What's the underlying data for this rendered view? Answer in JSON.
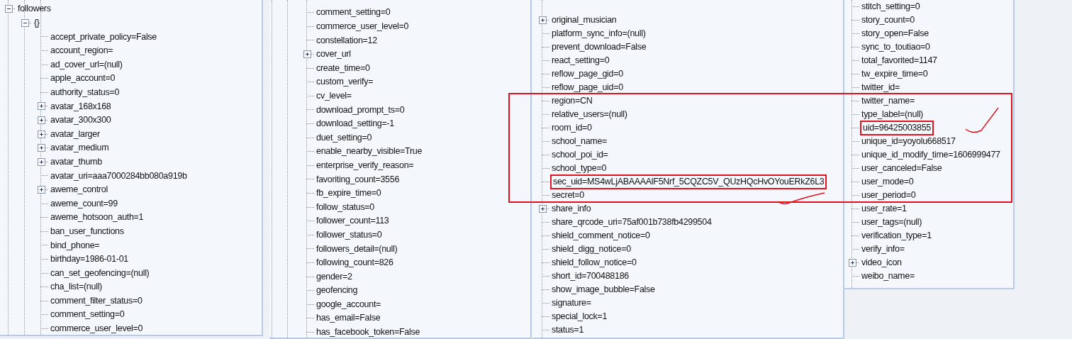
{
  "panels": [
    {
      "items": [
        {
          "kind": "node",
          "text": "followers",
          "expanded": true,
          "children": [
            {
              "kind": "node",
              "text": "{}",
              "expanded": true,
              "children": [
                {
                  "kind": "leaf",
                  "text": "accept_private_policy=False"
                },
                {
                  "kind": "leaf",
                  "text": "account_region="
                },
                {
                  "kind": "leaf",
                  "text": "ad_cover_url=(null)"
                },
                {
                  "kind": "leaf",
                  "text": "apple_account=0"
                },
                {
                  "kind": "leaf",
                  "text": "authority_status=0"
                },
                {
                  "kind": "node",
                  "text": "avatar_168x168",
                  "expanded": false
                },
                {
                  "kind": "node",
                  "text": "avatar_300x300",
                  "expanded": false
                },
                {
                  "kind": "node",
                  "text": "avatar_larger",
                  "expanded": false
                },
                {
                  "kind": "node",
                  "text": "avatar_medium",
                  "expanded": false
                },
                {
                  "kind": "node",
                  "text": "avatar_thumb",
                  "expanded": false
                },
                {
                  "kind": "leaf",
                  "text": "avatar_uri=aaa7000284bb080a919b"
                },
                {
                  "kind": "node",
                  "text": "aweme_control",
                  "expanded": false
                },
                {
                  "kind": "leaf",
                  "text": "aweme_count=99"
                },
                {
                  "kind": "leaf",
                  "text": "aweme_hotsoon_auth=1"
                },
                {
                  "kind": "leaf",
                  "text": "ban_user_functions"
                },
                {
                  "kind": "leaf",
                  "text": "bind_phone="
                },
                {
                  "kind": "leaf",
                  "text": "birthday=1986-01-01"
                },
                {
                  "kind": "leaf",
                  "text": "can_set_geofencing=(null)"
                },
                {
                  "kind": "leaf",
                  "text": "cha_list=(null)"
                },
                {
                  "kind": "leaf",
                  "text": "comment_filter_status=0"
                },
                {
                  "kind": "leaf",
                  "text": "comment_setting=0"
                },
                {
                  "kind": "leaf",
                  "text": "commerce_user_level=0"
                }
              ]
            }
          ]
        }
      ]
    },
    {
      "items": [
        {
          "kind": "leaf",
          "text": "comment_setting=0"
        },
        {
          "kind": "leaf",
          "text": "commerce_user_level=0"
        },
        {
          "kind": "leaf",
          "text": "constellation=12"
        },
        {
          "kind": "node",
          "text": "cover_url",
          "expanded": false
        },
        {
          "kind": "leaf",
          "text": "create_time=0"
        },
        {
          "kind": "leaf",
          "text": "custom_verify="
        },
        {
          "kind": "leaf",
          "text": "cv_level="
        },
        {
          "kind": "leaf",
          "text": "download_prompt_ts=0"
        },
        {
          "kind": "leaf",
          "text": "download_setting=-1"
        },
        {
          "kind": "leaf",
          "text": "duet_setting=0"
        },
        {
          "kind": "leaf",
          "text": "enable_nearby_visible=True"
        },
        {
          "kind": "leaf",
          "text": "enterprise_verify_reason="
        },
        {
          "kind": "leaf",
          "text": "favoriting_count=3556"
        },
        {
          "kind": "leaf",
          "text": "fb_expire_time=0"
        },
        {
          "kind": "leaf",
          "text": "follow_status=0"
        },
        {
          "kind": "leaf",
          "text": "follower_count=113"
        },
        {
          "kind": "leaf",
          "text": "follower_status=0"
        },
        {
          "kind": "leaf",
          "text": "followers_detail=(null)"
        },
        {
          "kind": "leaf",
          "text": "following_count=826"
        },
        {
          "kind": "leaf",
          "text": "gender=2"
        },
        {
          "kind": "leaf",
          "text": "geofencing"
        },
        {
          "kind": "leaf",
          "text": "google_account="
        },
        {
          "kind": "leaf",
          "text": "has_email=False"
        },
        {
          "kind": "leaf",
          "text": "has_facebook_token=False"
        }
      ]
    },
    {
      "items": [
        {
          "kind": "node",
          "text": "original_musician",
          "expanded": false
        },
        {
          "kind": "leaf",
          "text": "platform_sync_info=(null)"
        },
        {
          "kind": "leaf",
          "text": "prevent_download=False"
        },
        {
          "kind": "leaf",
          "text": "react_setting=0"
        },
        {
          "kind": "leaf",
          "text": "reflow_page_gid=0"
        },
        {
          "kind": "leaf",
          "text": "reflow_page_uid=0"
        },
        {
          "kind": "leaf",
          "text": "region=CN"
        },
        {
          "kind": "leaf",
          "text": "relative_users=(null)"
        },
        {
          "kind": "leaf",
          "text": "room_id=0"
        },
        {
          "kind": "leaf",
          "text": "school_name="
        },
        {
          "kind": "leaf",
          "text": "school_poi_id="
        },
        {
          "kind": "leaf",
          "text": "school_type=0"
        },
        {
          "kind": "leaf",
          "text": "sec_uid=MS4wLjABAAAAlF5Nrf_5CQZC5V_QUzHQcHvOYouERkZ6L3",
          "highlighted": true
        },
        {
          "kind": "leaf",
          "text": "secret=0"
        },
        {
          "kind": "node",
          "text": "share_info",
          "expanded": false
        },
        {
          "kind": "leaf",
          "text": "share_qrcode_uri=75af001b738fb4299504"
        },
        {
          "kind": "leaf",
          "text": "shield_comment_notice=0"
        },
        {
          "kind": "leaf",
          "text": "shield_digg_notice=0"
        },
        {
          "kind": "leaf",
          "text": "shield_follow_notice=0"
        },
        {
          "kind": "leaf",
          "text": "short_id=700488186"
        },
        {
          "kind": "leaf",
          "text": "show_image_bubble=False"
        },
        {
          "kind": "leaf",
          "text": "signature="
        },
        {
          "kind": "leaf",
          "text": "special_lock=1"
        },
        {
          "kind": "leaf",
          "text": "status=1"
        }
      ]
    },
    {
      "items": [
        {
          "kind": "leaf",
          "text": "stitch_setting=0"
        },
        {
          "kind": "leaf",
          "text": "story_count=0"
        },
        {
          "kind": "leaf",
          "text": "story_open=False"
        },
        {
          "kind": "leaf",
          "text": "sync_to_toutiao=0"
        },
        {
          "kind": "leaf",
          "text": "total_favorited=1147"
        },
        {
          "kind": "leaf",
          "text": "tw_expire_time=0"
        },
        {
          "kind": "leaf",
          "text": "twitter_id="
        },
        {
          "kind": "leaf",
          "text": "twitter_name="
        },
        {
          "kind": "leaf",
          "text": "type_label=(null)"
        },
        {
          "kind": "leaf",
          "text": "uid=96425003855",
          "highlighted": true
        },
        {
          "kind": "leaf",
          "text": "unique_id=yoyolu668517"
        },
        {
          "kind": "leaf",
          "text": "unique_id_modify_time=1606999477"
        },
        {
          "kind": "leaf",
          "text": "user_canceled=False"
        },
        {
          "kind": "leaf",
          "text": "user_mode=0"
        },
        {
          "kind": "leaf",
          "text": "user_period=0"
        },
        {
          "kind": "leaf",
          "text": "user_rate=1"
        },
        {
          "kind": "leaf",
          "text": "user_tags=(null)"
        },
        {
          "kind": "leaf",
          "text": "verification_type=1"
        },
        {
          "kind": "leaf",
          "text": "verify_info="
        },
        {
          "kind": "node",
          "text": "video_icon",
          "expanded": false
        },
        {
          "kind": "leaf",
          "text": "weibo_name="
        }
      ]
    }
  ]
}
